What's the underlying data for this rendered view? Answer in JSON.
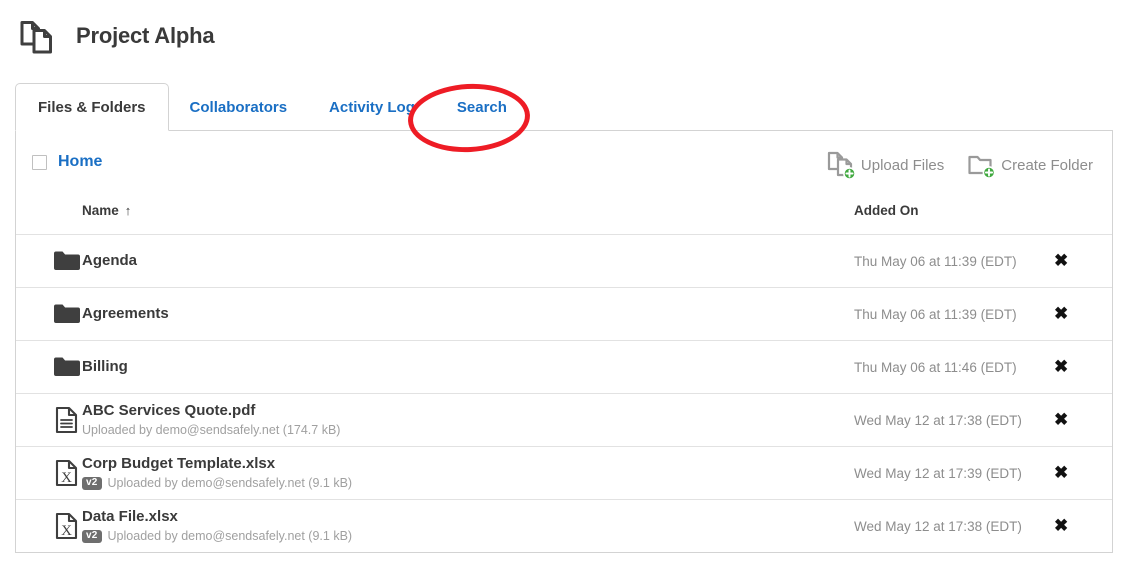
{
  "header": {
    "title": "Project Alpha",
    "logo_icon": "documents-icon"
  },
  "tabs": [
    {
      "label": "Files & Folders",
      "active": true
    },
    {
      "label": "Collaborators",
      "active": false
    },
    {
      "label": "Activity Log",
      "active": false
    },
    {
      "label": "Search",
      "active": false
    }
  ],
  "toolbar": {
    "breadcrumb": "Home",
    "select_all_checkbox": "unchecked",
    "upload_files_label": "Upload Files",
    "upload_files_icon": "upload-files-icon",
    "create_folder_label": "Create Folder",
    "create_folder_icon": "create-folder-icon"
  },
  "table": {
    "columns": {
      "name": "Name",
      "sort_arrow": "↑",
      "added_on": "Added On"
    },
    "rows": [
      {
        "icon": "folder-icon",
        "type": "folder",
        "name": "Agenda",
        "subtitle": "",
        "version": "",
        "added_on": "Thu May 06 at 11:39 (EDT)",
        "delete": "✖"
      },
      {
        "icon": "folder-icon",
        "type": "folder",
        "name": "Agreements",
        "subtitle": "",
        "version": "",
        "added_on": "Thu May 06 at 11:39 (EDT)",
        "delete": "✖"
      },
      {
        "icon": "folder-icon",
        "type": "folder",
        "name": "Billing",
        "subtitle": "",
        "version": "",
        "added_on": "Thu May 06 at 11:46 (EDT)",
        "delete": "✖"
      },
      {
        "icon": "pdf-file-icon",
        "type": "pdf",
        "name": "ABC Services Quote.pdf",
        "subtitle": "Uploaded by demo@sendsafely.net (174.7 kB)",
        "version": "",
        "added_on": "Wed May 12 at 17:38 (EDT)",
        "delete": "✖"
      },
      {
        "icon": "xlsx-file-icon",
        "type": "xlsx",
        "name": "Corp Budget Template.xlsx",
        "subtitle": "Uploaded by demo@sendsafely.net (9.1 kB)",
        "version": "v2",
        "added_on": "Wed May 12 at 17:39 (EDT)",
        "delete": "✖"
      },
      {
        "icon": "xlsx-file-icon",
        "type": "xlsx",
        "name": "Data File.xlsx",
        "subtitle": "Uploaded by demo@sendsafely.net (9.1 kB)",
        "version": "v2",
        "added_on": "Wed May 12 at 17:38 (EDT)",
        "delete": "✖"
      }
    ]
  },
  "annotation": {
    "shape": "ellipse",
    "color": "#ee1c25",
    "targets": "Search"
  },
  "colors": {
    "link_blue": "#1a6fc4",
    "text_dark": "#3a3a3a",
    "muted_gray": "#8d8d8d",
    "border": "#d3d3d3",
    "accent_green": "#41a940",
    "annotation_red": "#ee1c25"
  }
}
